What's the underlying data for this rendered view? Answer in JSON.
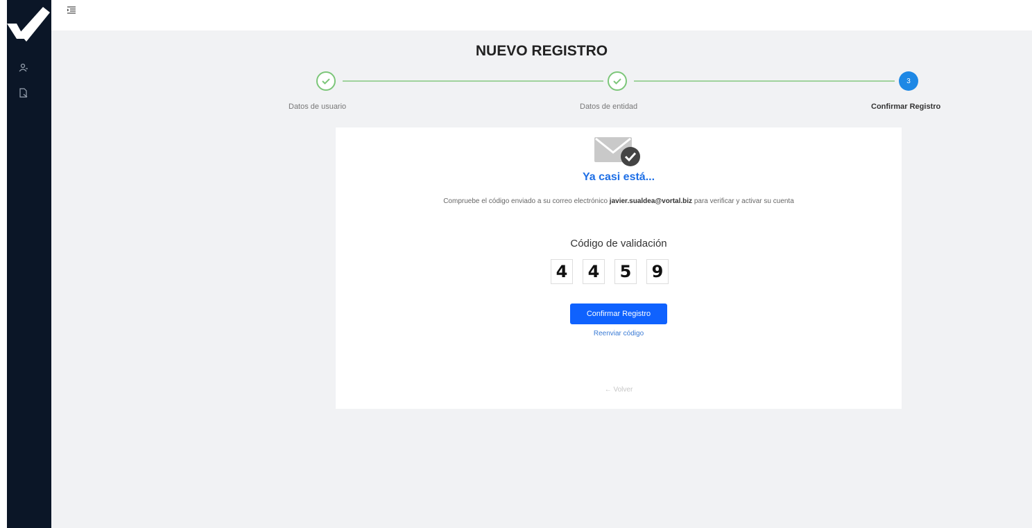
{
  "sidebar": {
    "items": [
      {
        "icon": "user-icon"
      },
      {
        "icon": "document-icon"
      }
    ]
  },
  "topbar": {
    "menu_icon": "menu-toggle-icon"
  },
  "page": {
    "title": "NUEVO REGISTRO"
  },
  "stepper": {
    "steps": [
      {
        "label": "Datos de usuario",
        "status": "done"
      },
      {
        "label": "Datos de entidad",
        "status": "done"
      },
      {
        "label": "Confirmar Registro",
        "status": "active",
        "number": "3"
      }
    ],
    "colors": {
      "done": "#7cc679",
      "active": "#1e88e5",
      "line": "#9fd29b"
    }
  },
  "card": {
    "icon": "mail-check-icon",
    "title": "Ya casi está...",
    "message_before": "Compruebe el código enviado a su correo electrónico ",
    "email": "javier.sualdea@vortal.biz",
    "message_after": " para verificar y activar su cuenta",
    "code_label": "Código de validación",
    "code_digits": [
      "4",
      "4",
      "5",
      "9"
    ],
    "confirm_button": "Confirmar Registro",
    "resend_link": "Reenviar código",
    "back_link": "← Volver"
  },
  "colors": {
    "sidebar": "#0b1627",
    "primary": "#0f62fe",
    "title": "#1e6fe6",
    "background": "#f1f2f4"
  }
}
